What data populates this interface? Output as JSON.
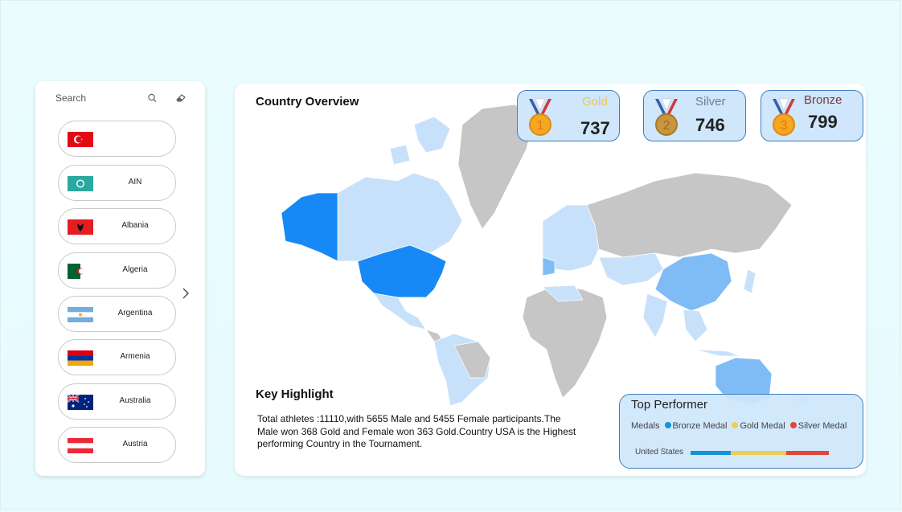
{
  "slicer": {
    "search_placeholder": "Search",
    "countries": [
      {
        "name": "",
        "flag": "turkey-flag"
      },
      {
        "name": "AIN",
        "flag": "ain-flag"
      },
      {
        "name": "Albania",
        "flag": "albania-flag"
      },
      {
        "name": "Algeria",
        "flag": "algeria-flag"
      },
      {
        "name": "Argentina",
        "flag": "argentina-flag"
      },
      {
        "name": "Armenia",
        "flag": "armenia-flag"
      },
      {
        "name": "Australia",
        "flag": "australia-flag"
      },
      {
        "name": "Austria",
        "flag": "austria-flag"
      }
    ]
  },
  "overview": {
    "title": "Country Overview"
  },
  "medals": {
    "gold": {
      "label": "Gold",
      "count": "737",
      "color": "#f2c94c"
    },
    "silver": {
      "label": "Silver",
      "count": "746",
      "color": "#6f7f8f"
    },
    "bronze": {
      "label": "Bronze",
      "count": "799",
      "color": "#7a3b3b"
    }
  },
  "key_highlight": {
    "title": "Key Highlight",
    "text": "Total athletes :11110,with 5655 Male and 5455 Female participants.The Male won 368 Gold and Female won 363 Gold.Country USA is the Highest performing Country in the Tournament."
  },
  "top_performer": {
    "title": "Top Performer",
    "legend_title": "Medals",
    "legend": [
      {
        "label": "Bronze Medal",
        "color": "#1592d8"
      },
      {
        "label": "Gold Medal",
        "color": "#f0cc5a"
      },
      {
        "label": "Silver Medal",
        "color": "#e0463a"
      }
    ],
    "country": "United States",
    "bar_fractions": [
      0.29,
      0.4,
      0.31
    ]
  },
  "colors": {
    "background": "#e9fbfd",
    "map_gray": "#c6c6c6",
    "map_light_blue": "#c8e1fa",
    "map_mid_blue": "#7fbcf5",
    "map_strong_blue": "#1789f6"
  }
}
